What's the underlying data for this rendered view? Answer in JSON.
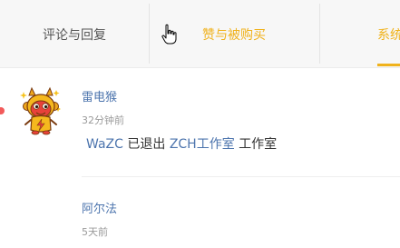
{
  "tabs": [
    {
      "label": "评论与回复",
      "active": false
    },
    {
      "label": "赞与被购买",
      "active": false
    },
    {
      "label": "系统",
      "active": true
    }
  ],
  "notifications": [
    {
      "username": "雷电猴",
      "time": "32分钟前",
      "message": {
        "actor": "WaZC",
        "action": "已退出",
        "target": "ZCH工作室",
        "suffix": "工作室"
      },
      "unread": true
    },
    {
      "username": "阿尔法",
      "time": "5天前"
    }
  ],
  "colors": {
    "accent": "#f0b21c",
    "link": "#4c74ad",
    "unread_dot": "#f25a5a"
  },
  "icons": {
    "cursor": "hand-pointer-icon",
    "avatar": "monkey-mascot-avatar"
  }
}
